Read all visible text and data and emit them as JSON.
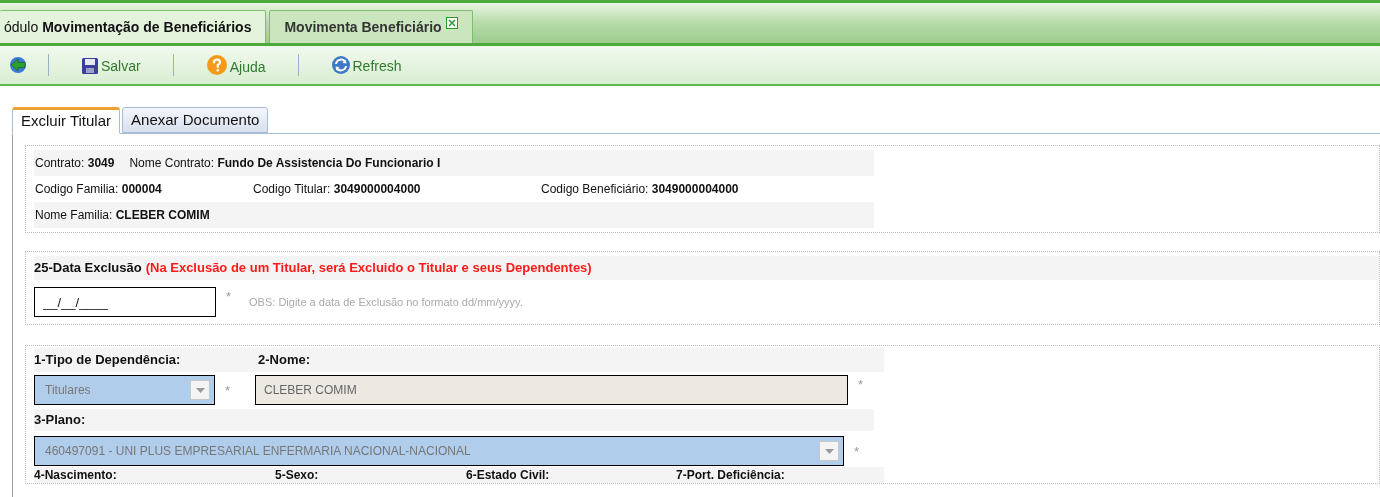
{
  "module_tabs": [
    {
      "label": "ódulo **Movimentação de Beneficiários**",
      "selected": false,
      "closable": false
    },
    {
      "label": "Movimenta Beneficiário",
      "selected": true,
      "closable": true
    }
  ],
  "toolbar": [
    {
      "kind": "back"
    },
    {
      "kind": "save",
      "label": "Salvar"
    },
    {
      "kind": "help",
      "label": "Ajuda"
    },
    {
      "kind": "refresh",
      "label": "Refresh"
    }
  ],
  "tabs": [
    {
      "label": "Excluir Titular",
      "selected": true
    },
    {
      "label": "Anexar Documento",
      "selected": false
    }
  ],
  "info": [
    [
      {
        "label": "Contrato:",
        "value": "3049"
      },
      {
        "label": "Nome Contrato:",
        "value": "Fundo De Assistencia Do Funcionario I"
      }
    ],
    [
      {
        "label": "Codigo Familia:",
        "value": "000004"
      },
      {
        "label": "Codigo Titular:",
        "value": "3049000004000"
      },
      {
        "label": "Codigo Beneficiário:",
        "value": "3049000004000"
      }
    ],
    [
      {
        "label": "Nome Familia:",
        "value": "CLEBER COMIM"
      }
    ]
  ],
  "exclusion": {
    "label": "25-Data Exclusão",
    "warning": "(Na Exclusão de um Titular, será Excluido o Titular e seus Dependentes)",
    "value": "__/__/____",
    "required_mark": "*",
    "note": "OBS: Digite a data de Exclusão no formato dd/mm/yyyy."
  },
  "form": {
    "dependency": {
      "label": "1-Tipo de Dependência:",
      "value": "Titulares",
      "required_mark": "*"
    },
    "name": {
      "label": "2-Nome:",
      "value": "CLEBER COMIM",
      "required_mark": "*"
    },
    "plan": {
      "label": "3-Plano:",
      "value": "460497091 - UNI PLUS EMPRESARIAL ENFERMARIA NACIONAL-NACIONAL",
      "required_mark": "*"
    },
    "next_labels": [
      "4-Nascimento:",
      "5-Sexo:",
      "6-Estado Civil:",
      "7-Port. Deficiência:"
    ]
  }
}
